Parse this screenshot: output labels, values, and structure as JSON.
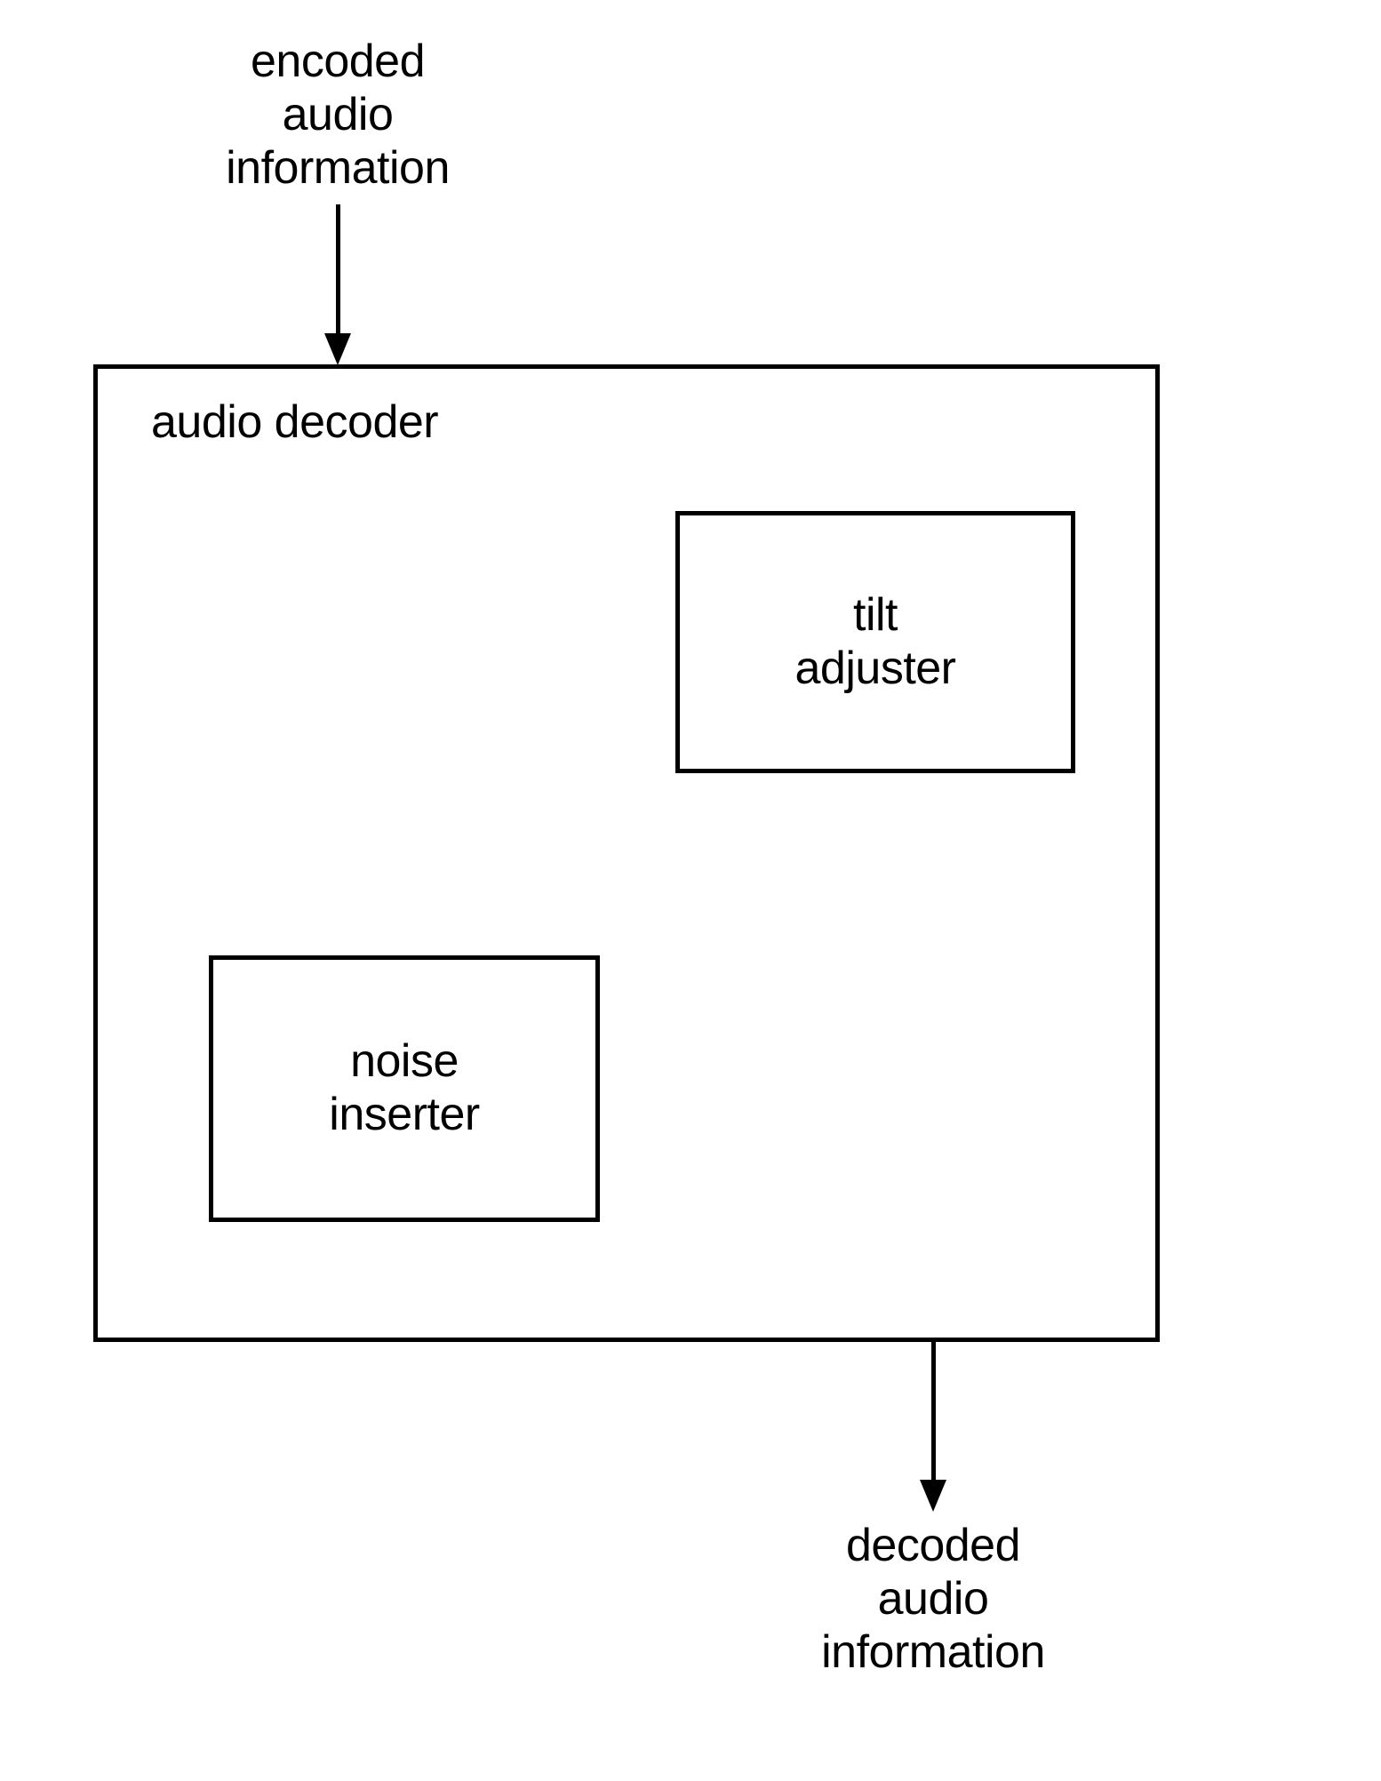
{
  "input": {
    "line1": "encoded",
    "line2": "audio",
    "line3": "information"
  },
  "decoder": {
    "title": "audio decoder",
    "tilt": {
      "line1": "tilt",
      "line2": "adjuster"
    },
    "noise": {
      "line1": "noise",
      "line2": "inserter"
    }
  },
  "output": {
    "line1": "decoded",
    "line2": "audio",
    "line3": "information"
  }
}
